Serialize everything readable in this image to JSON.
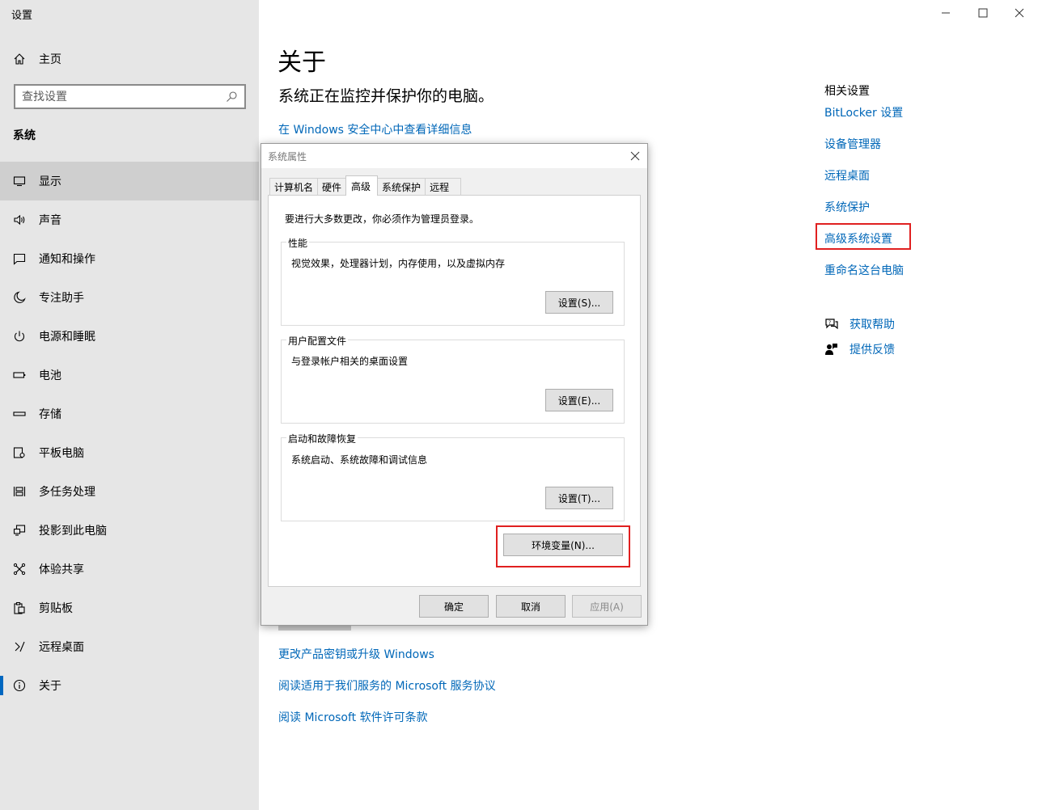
{
  "app": {
    "title": "设置"
  },
  "sidebar": {
    "home_label": "主页",
    "search_placeholder": "查找设置",
    "section_title": "系统",
    "items": [
      {
        "label": "显示",
        "icon": "monitor-icon"
      },
      {
        "label": "声音",
        "icon": "speaker-icon"
      },
      {
        "label": "通知和操作",
        "icon": "notification-icon"
      },
      {
        "label": "专注助手",
        "icon": "moon-icon"
      },
      {
        "label": "电源和睡眠",
        "icon": "power-icon"
      },
      {
        "label": "电池",
        "icon": "battery-icon"
      },
      {
        "label": "存储",
        "icon": "storage-icon"
      },
      {
        "label": "平板电脑",
        "icon": "tablet-icon"
      },
      {
        "label": "多任务处理",
        "icon": "multitask-icon"
      },
      {
        "label": "投影到此电脑",
        "icon": "project-icon"
      },
      {
        "label": "体验共享",
        "icon": "share-icon"
      },
      {
        "label": "剪贴板",
        "icon": "clipboard-icon"
      },
      {
        "label": "远程桌面",
        "icon": "remote-icon"
      },
      {
        "label": "关于",
        "icon": "info-icon"
      }
    ]
  },
  "main": {
    "title": "关于",
    "status": "系统正在监控并保护你的电脑。",
    "security_link": "在 Windows 安全中心中查看详细信息",
    "links": [
      "更改产品密钥或升级 Windows",
      "阅读适用于我们服务的 Microsoft 服务协议",
      "阅读 Microsoft 软件许可条款"
    ]
  },
  "related": {
    "title": "相关设置",
    "links": [
      "BitLocker 设置",
      "设备管理器",
      "远程桌面",
      "系统保护",
      "高级系统设置",
      "重命名这台电脑"
    ],
    "help": "获取帮助",
    "feedback": "提供反馈"
  },
  "dialog": {
    "title": "系统属性",
    "tabs": [
      "计算机名",
      "硬件",
      "高级",
      "系统保护",
      "远程"
    ],
    "admin_note": "要进行大多数更改，你必须作为管理员登录。",
    "performance": {
      "label": "性能",
      "desc": "视觉效果，处理器计划，内存使用，以及虚拟内存",
      "button": "设置(S)..."
    },
    "profile": {
      "label": "用户配置文件",
      "desc": "与登录帐户相关的桌面设置",
      "button": "设置(E)..."
    },
    "startup": {
      "label": "启动和故障恢复",
      "desc": "系统启动、系统故障和调试信息",
      "button": "设置(T)..."
    },
    "env_button": "环境变量(N)...",
    "ok": "确定",
    "cancel": "取消",
    "apply": "应用(A)"
  },
  "colors": {
    "accent_link": "#0067b8",
    "highlight": "#e02020",
    "sidebar_bg": "#e6e6e6"
  }
}
